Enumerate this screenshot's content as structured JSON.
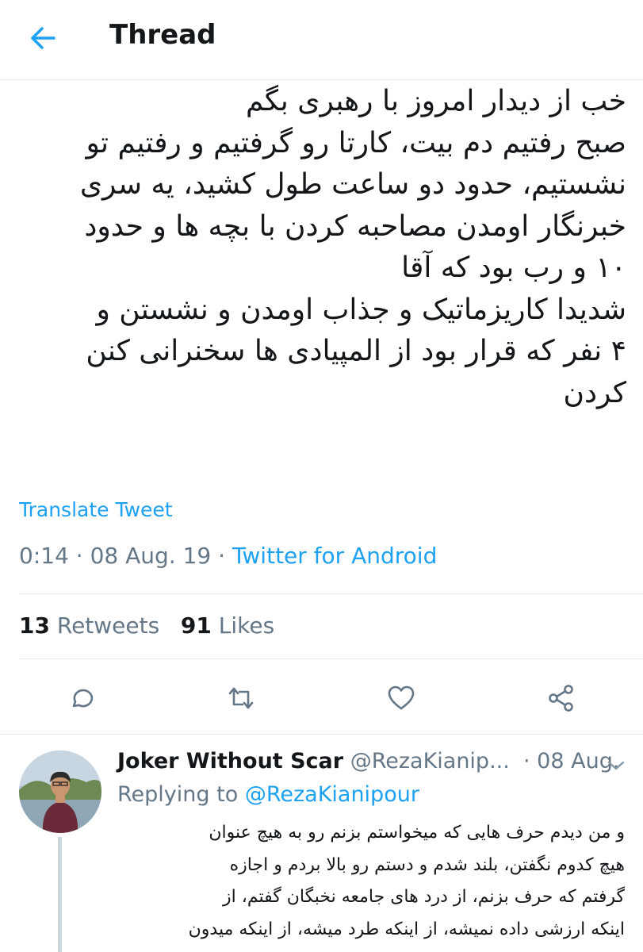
{
  "header": {
    "title": "Thread"
  },
  "tweet": {
    "lines": [
      "خب از دیدار امروز با رهبری بگم",
      "صبح رفتیم دم بیت، کارتا رو گرفتیم و رفتیم تو",
      "نشستیم، حدود دو ساعت طول کشید، یه سری",
      "خبرنگار اومدن مصاحبه کردن با بچه ها و حدود",
      "۱۰ و رب بود که آقا",
      "شدیدا کاریزماتیک و جذاب اومدن و نشستن و",
      "۴ نفر که قرار بود از المپیادی ها سخنرانی کنن",
      "کردن"
    ],
    "translate_label": "Translate Tweet",
    "time": "0:14",
    "date": "08 Aug. 19",
    "sep": " · ",
    "app": "Twitter for Android",
    "retweets_count": "13",
    "retweets_label": "Retweets",
    "likes_count": "91",
    "likes_label": "Likes"
  },
  "actions": [
    "reply-icon",
    "retweet-icon",
    "like-icon",
    "share-icon"
  ],
  "reply": {
    "name": "Joker Without Scar",
    "handle": "@RezaKianip...",
    "date": "08 Aug.",
    "replying_prefix": "Replying to",
    "replying_handle": "@RezaKianipour",
    "lines": [
      "و من دیدم حرف هایی که میخواستم بزنم رو به هیچ عنوان",
      "هیچ کدوم نگفتن، بلند شدم و دستم رو بالا بردم و اجازه",
      "گرفتم که حرف بزنم، از درد های جامعه نخبگان گفتم، از",
      "اینکه ارزشی داده نمیشه، از اینکه طرد میشه، از اینکه میدون"
    ]
  },
  "colors": {
    "accent": "#1da1f2",
    "muted": "#657786",
    "text": "#14171a",
    "divider": "#e6ecf0"
  }
}
